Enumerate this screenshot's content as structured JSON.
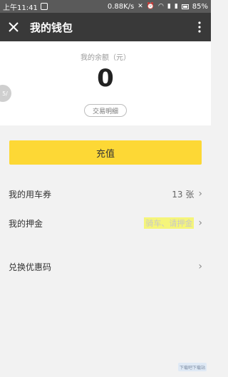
{
  "status_bar": {
    "time": "上午11:41",
    "network_speed": "0.88K/s",
    "battery": "85%"
  },
  "title_bar": {
    "title": "我的钱包"
  },
  "balance": {
    "label": "我的余额（元）",
    "value": "0",
    "transactions_button": "交易明细",
    "side_tab": "5/"
  },
  "recharge": {
    "label": "充值"
  },
  "rows": [
    {
      "label": "我的用车券",
      "value": "13 张"
    },
    {
      "label": "我的押金",
      "value": "骑车、请押金"
    },
    {
      "label": "兑换优惠码",
      "value": ""
    }
  ],
  "watermark": "下载吧下载站"
}
